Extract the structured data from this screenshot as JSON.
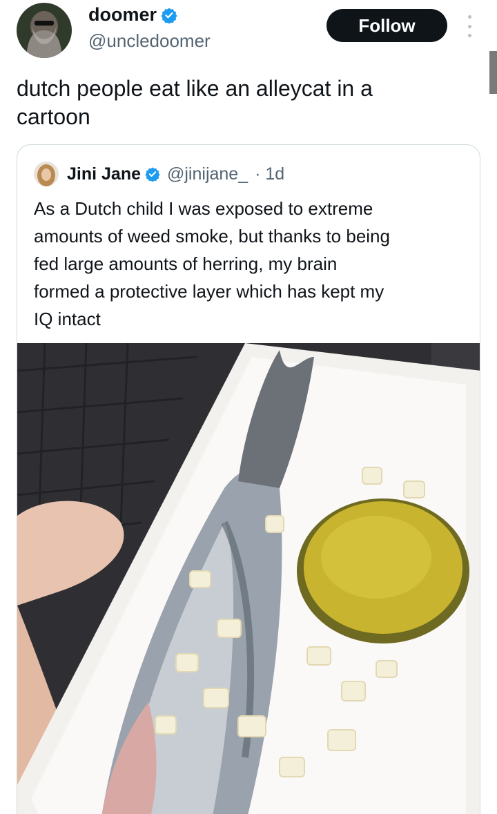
{
  "author": {
    "name": "doomer",
    "handle": "@uncledoomer",
    "verified": true
  },
  "follow_label": "Follow",
  "tweet_text": "dutch people eat like an alleycat in a\ncartoon",
  "quoted": {
    "name": "Jini Jane",
    "verified": true,
    "handle": "@jinijane_",
    "time": "· 1d",
    "text": "As a Dutch child I was exposed to extreme\namounts of weed smoke, but thanks to being\nfed large amounts of herring, my brain\nformed a protective layer which has kept my\nIQ intact"
  },
  "colors": {
    "verified_blue": "#1d9bf0",
    "text_primary": "#0f1419",
    "text_secondary": "#536471",
    "follow_bg": "#0f1419",
    "border": "#cfd9de"
  }
}
